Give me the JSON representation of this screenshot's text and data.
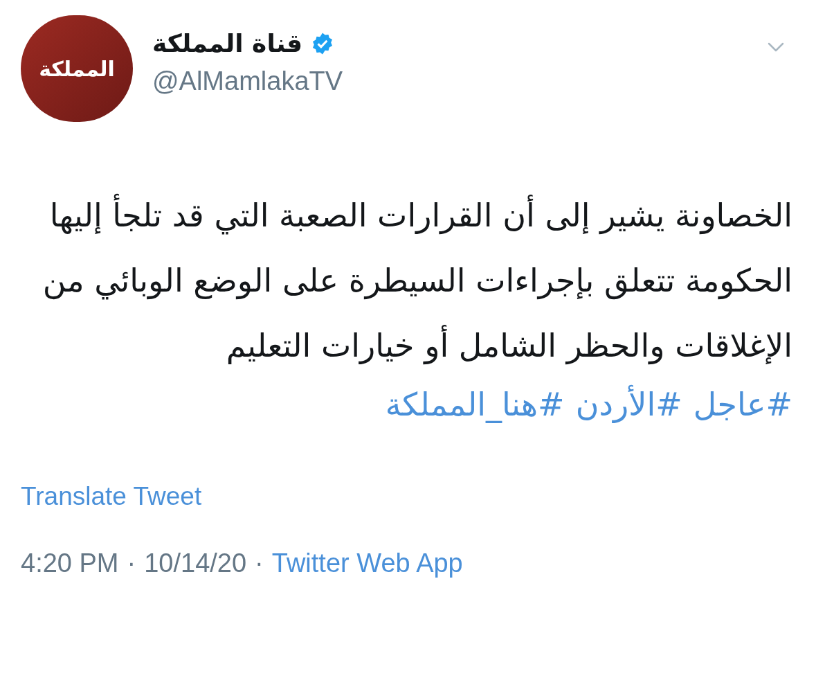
{
  "account": {
    "avatar_text": "المملكة",
    "name": "قناة المملكة",
    "verified": true,
    "handle": "@AlMamlakaTV"
  },
  "tweet": {
    "text": "الخصاونة يشير إلى أن القرارات الصعبة التي قد تلجأ إليها الحكومة تتعلق بإجراءات السيطرة على الوضع الوبائي من الإغلاقات والحظر الشامل أو خيارات التعليم",
    "hashtags": [
      "#عاجل",
      "#الأردن",
      "#هنا_المملكة"
    ]
  },
  "translate_link": "Translate Tweet",
  "meta": {
    "time": "4:20 PM",
    "separator": "·",
    "date": "10/14/20",
    "source": "Twitter Web App"
  }
}
